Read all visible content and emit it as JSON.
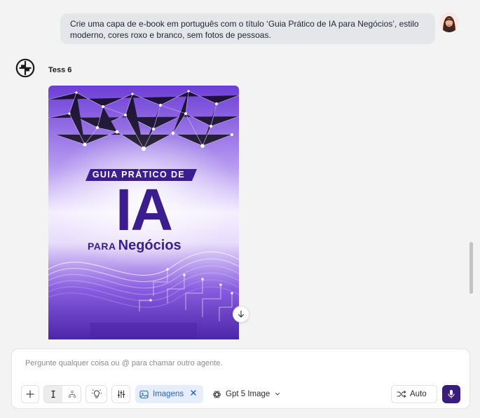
{
  "conversation": {
    "user_message": "Crie uma capa de e-book em português com o título ‘Guia Prático de IA para Negócios’, estilo moderno, cores roxo e branco, sem fotos de pessoas.",
    "agent_name": "Tess 6",
    "image": {
      "banner_text": "GUIA PRÁTICO DE",
      "big_text": "IA",
      "sub_small": "PARA",
      "sub_large": "Negócios"
    }
  },
  "composer": {
    "placeholder": "Pergunte qualquer coisa ou @ para chamar outro agente.",
    "tool_chip_label": "Imagens",
    "model_label": "Gpt 5 Image",
    "mode_label": "Auto"
  },
  "icons": {
    "attach": "plus-icon",
    "mode_on": "cursor-text-icon",
    "mode_off": "network-icon",
    "ideas": "lightbulb-icon",
    "settings": "sliders-icon",
    "chip": "image-icon",
    "chip_remove": "close-icon",
    "model": "openai-logo-icon",
    "model_menu": "chevron-down-icon",
    "auto": "shuffle-icon",
    "voice": "microphone-icon",
    "scroll": "arrow-down-icon"
  },
  "colors": {
    "accent": "#3a1d7a",
    "chip_bg": "#e7eefb",
    "chip_text": "#2563c9",
    "cover_title": "#3b1d8f"
  }
}
